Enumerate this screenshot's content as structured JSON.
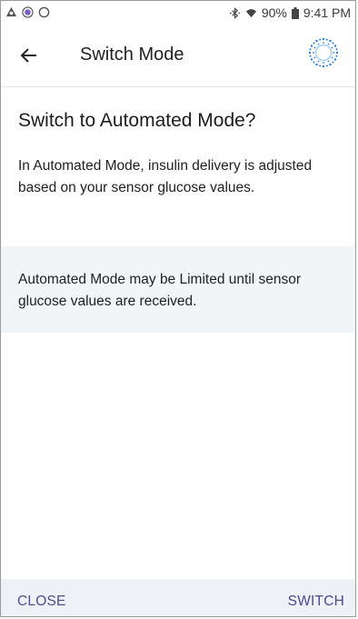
{
  "status_bar": {
    "battery": "90%",
    "time": "9:41 PM",
    "icons": [
      "warning-triangle-icon",
      "record-icon",
      "circle-icon",
      "bluetooth-icon",
      "wifi-icon",
      "battery-icon"
    ]
  },
  "header": {
    "title": "Switch Mode",
    "back_icon": "arrow-left-icon",
    "status_icon": "pod-status-icon"
  },
  "dialog": {
    "title": "Switch to Automated Mode?",
    "body": "In Automated Mode, insulin delivery is adjusted based on your sensor glucose values.",
    "info": "Automated Mode may be Limited until sensor glucose values are received."
  },
  "footer": {
    "close_label": "CLOSE",
    "switch_label": "SWITCH"
  },
  "colors": {
    "accent": "#4f4e8e",
    "info_background": "#f1f5f8",
    "footer_background": "#eef2f6",
    "pod_icon": "#2f7fd8"
  }
}
